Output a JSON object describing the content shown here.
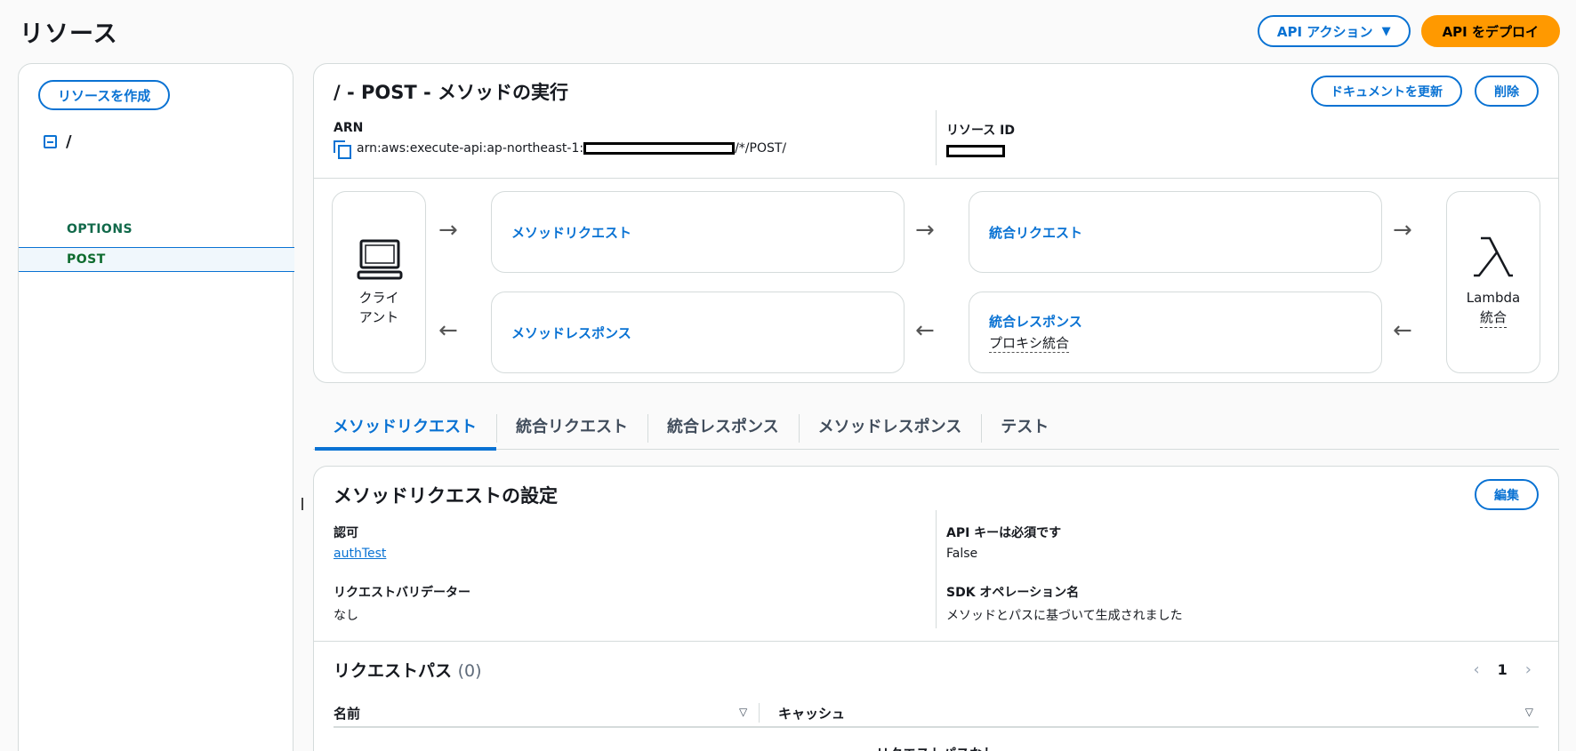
{
  "page": {
    "title": "リソース",
    "api_actions_label": "API アクション",
    "deploy_label": "API をデプロイ"
  },
  "sidebar": {
    "create_resource_label": "リソースを作成",
    "root_path": "/",
    "methods": [
      "OPTIONS",
      "POST"
    ]
  },
  "execution": {
    "title": "/ - POST - メソッドの実行",
    "update_docs_label": "ドキュメントを更新",
    "delete_label": "削除",
    "arn_label": "ARN",
    "arn_prefix": "arn:aws:execute-api:ap-northeast-1:",
    "arn_suffix": "/*/POST/",
    "resource_id_label": "リソース ID",
    "client_label_line1": "クライ",
    "client_label_line2": "アント",
    "method_request": "メソッドリクエスト",
    "integration_request": "統合リクエスト",
    "method_response": "メソッドレスポンス",
    "integration_response": "統合レスポンス",
    "integration_response_sub": "プロキシ統合",
    "lambda_label": "Lambda",
    "lambda_sub": "統合"
  },
  "tabs": [
    {
      "label": "メソッドリクエスト",
      "active": true
    },
    {
      "label": "統合リクエスト",
      "active": false
    },
    {
      "label": "統合レスポンス",
      "active": false
    },
    {
      "label": "メソッドレスポンス",
      "active": false
    },
    {
      "label": "テスト",
      "active": false
    }
  ],
  "settings": {
    "title": "メソッドリクエストの設定",
    "edit_label": "編集",
    "authorization_label": "認可",
    "authorization_value": "authTest",
    "api_key_label": "API キーは必須です",
    "api_key_value": "False",
    "validator_label": "リクエストバリデーター",
    "validator_value": "なし",
    "sdk_op_label": "SDK オペレーション名",
    "sdk_op_value": "メソッドとパスに基づいて生成されました"
  },
  "request_paths": {
    "title": "リクエストパス",
    "count": "(0)",
    "page": "1",
    "col_name": "名前",
    "col_cache": "キャッシュ",
    "empty_text": "リクエストパスなし"
  },
  "colors": {
    "accent": "#0972d3",
    "primary_button": "#ff9900",
    "method_green": "#037f51"
  },
  "icons": {
    "collapse": "collapse-icon",
    "copy": "copy-icon",
    "client": "laptop-icon",
    "lambda": "lambda-icon"
  }
}
